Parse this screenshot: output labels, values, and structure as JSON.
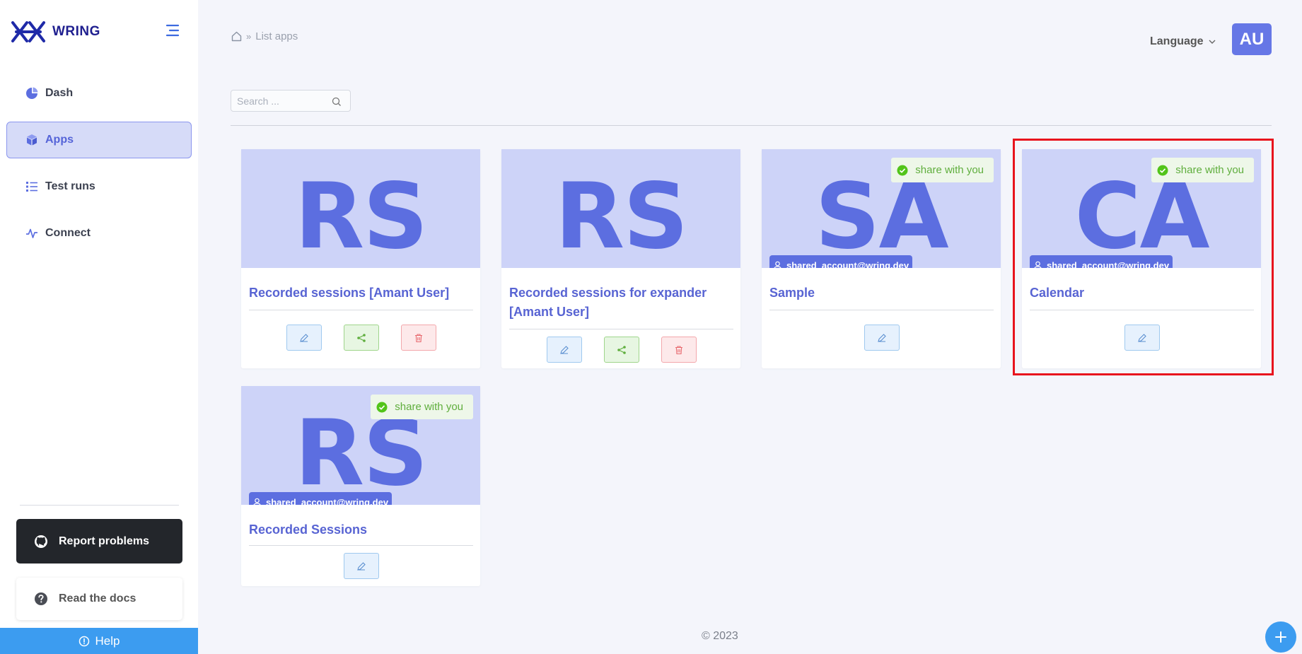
{
  "app": {
    "name": "WRING"
  },
  "sidebar": {
    "items": [
      {
        "label": "Dash",
        "icon": "pie-chart-icon",
        "active": false
      },
      {
        "label": "Apps",
        "icon": "cube-icon",
        "active": true
      },
      {
        "label": "Test runs",
        "icon": "list-icon",
        "active": false
      },
      {
        "label": "Connect",
        "icon": "activity-icon",
        "active": false
      }
    ],
    "report_label": "Report problems",
    "docs_label": "Read the docs",
    "help_label": "Help"
  },
  "header": {
    "breadcrumb": "List apps",
    "language_label": "Language",
    "avatar_initials": "AU"
  },
  "search": {
    "placeholder": "Search ..."
  },
  "apps": [
    {
      "initials": "RS",
      "title": "Recorded sessions [Amant User]",
      "shared": false,
      "owner": "",
      "actions": [
        "edit",
        "share",
        "delete"
      ]
    },
    {
      "initials": "RS",
      "title": "Recorded sessions for expander [Amant User]",
      "shared": false,
      "owner": "",
      "actions": [
        "edit",
        "share",
        "delete"
      ]
    },
    {
      "initials": "SA",
      "title": "Sample",
      "shared": true,
      "share_label": "share with you",
      "owner": "shared_account@wring.dev",
      "actions": [
        "edit"
      ]
    },
    {
      "initials": "CA",
      "title": "Calendar",
      "shared": true,
      "share_label": "share with you",
      "owner": "shared_account@wring.dev",
      "actions": [
        "edit"
      ]
    },
    {
      "initials": "RS",
      "title": "Recorded Sessions",
      "shared": true,
      "share_label": "share with you",
      "owner": "shared_account@wring.dev",
      "actions": [
        "edit"
      ]
    }
  ],
  "footer": {
    "copyright": "© 2023"
  },
  "colors": {
    "accent": "#5c6ee0",
    "banner": "#cdd3f8",
    "help": "#3c9cf0",
    "highlight": "#e8141d"
  }
}
